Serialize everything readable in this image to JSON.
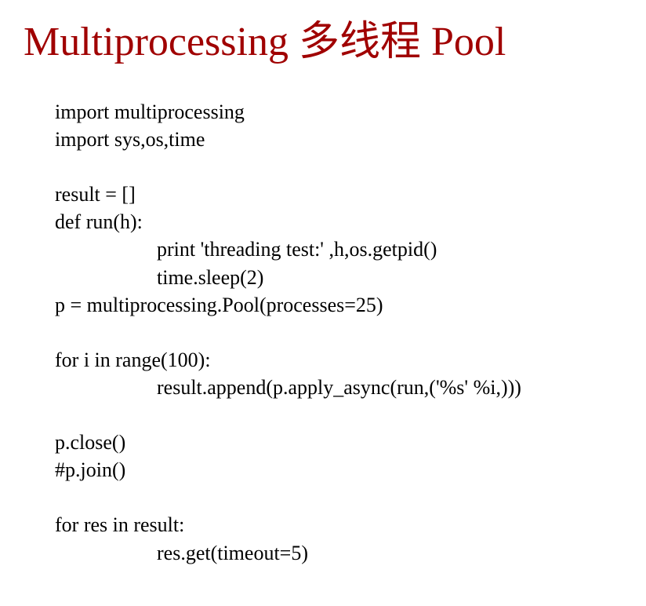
{
  "title": "Multiprocessing 多线程 Pool",
  "code": {
    "l1": "import multiprocessing",
    "l2": "import sys,os,time",
    "l3": "result = []",
    "l4": "def run(h):",
    "l5": "print 'threading test:' ,h,os.getpid()",
    "l6": "time.sleep(2)",
    "l7": "p = multiprocessing.Pool(processes=25)",
    "l8": "for i in range(100):",
    "l9": "result.append(p.apply_async(run,('%s' %i,)))",
    "l10": "p.close()",
    "l11": "#p.join()",
    "l12": "for res in result:",
    "l13": "res.get(timeout=5)"
  }
}
